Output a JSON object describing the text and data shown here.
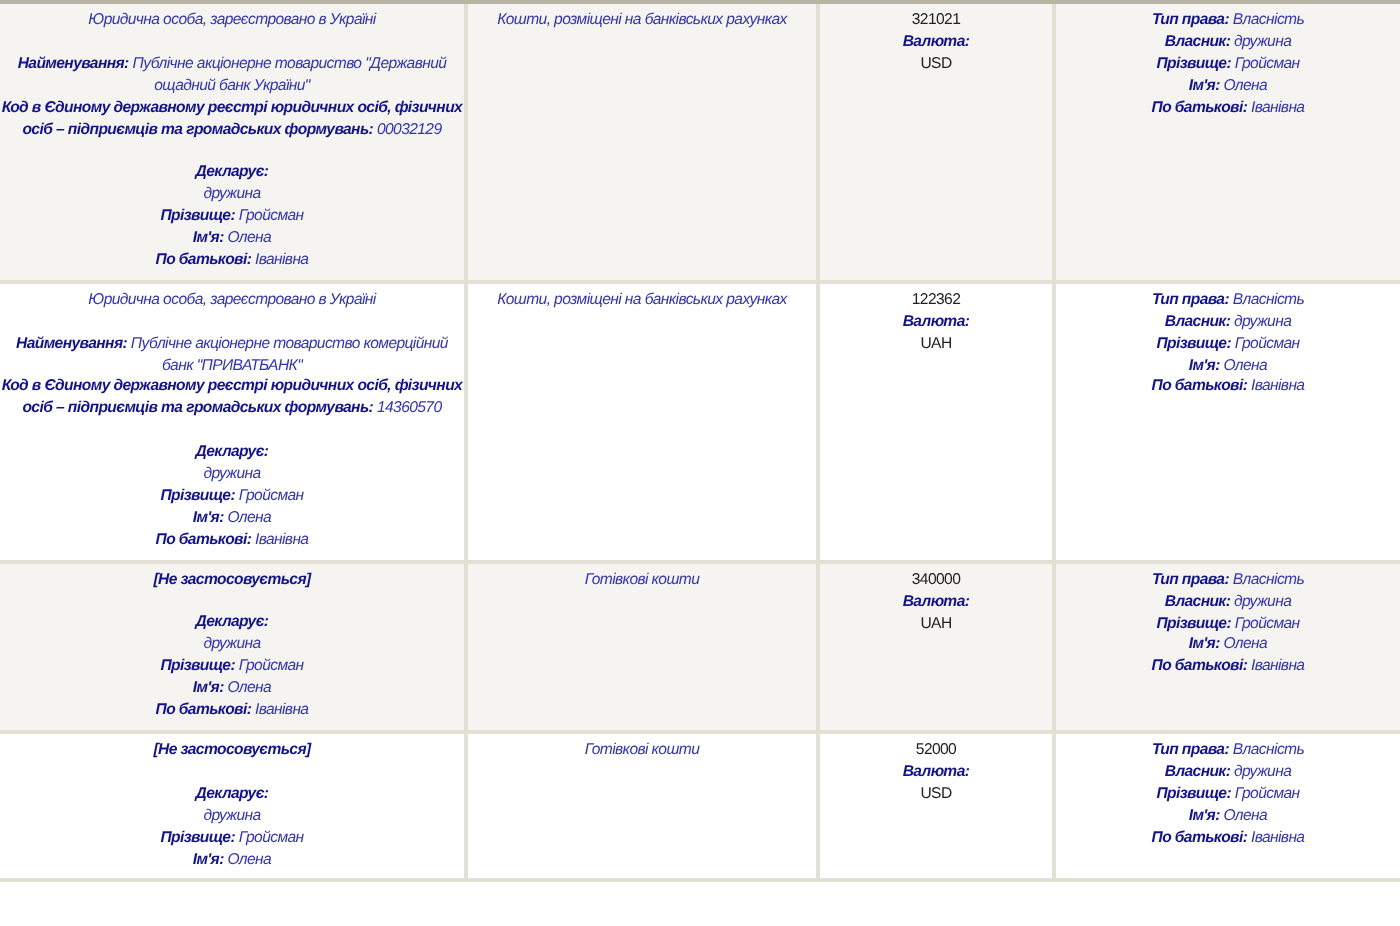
{
  "rows": [
    {
      "entity": {
        "kind": "plain",
        "text": "Юридична особа, зареєстровано в Україні"
      },
      "details": [
        {
          "label": "Найменування:",
          "value": "Публічне акціонерне товариство \"Державний ощадний банк України\""
        },
        {
          "label": "Код в Єдиному державному реєстрі юридичних осіб, фізичних осіб – підприємців та громадських формувань:",
          "value": "00032129"
        }
      ],
      "declarant": {
        "label": "Декларує:",
        "value": "дружина"
      },
      "persons": [
        {
          "label": "Прізвище:",
          "value": "Гройсман"
        },
        {
          "label": "Ім'я:",
          "value": "Олена"
        },
        {
          "label": "По батькові:",
          "value": "Іванівна"
        }
      ],
      "asset_type": "Кошти, розміщені на банківських рахунках",
      "amount": "321021",
      "currency_label": "Валюта:",
      "currency": "USD",
      "rights": [
        {
          "label": "Тип права:",
          "value": "Власність"
        },
        {
          "label": "Власник:",
          "value": "дружина"
        },
        {
          "label": "Прізвище:",
          "value": "Гройсман"
        },
        {
          "label": "Ім'я:",
          "value": "Олена"
        },
        {
          "label": "По батькові:",
          "value": "Іванівна"
        }
      ]
    },
    {
      "entity": {
        "kind": "plain",
        "text": "Юридична особа, зареєстровано в Україні"
      },
      "details": [
        {
          "label": "Найменування:",
          "value": "Публічне акціонерне товариство комерційний банк \"ПРИВАТБАНК\""
        },
        {
          "label": "Код в Єдиному державному реєстрі юридичних осіб, фізичних осіб – підприємців та громадських формувань:",
          "value": "14360570"
        }
      ],
      "declarant": {
        "label": "Декларує:",
        "value": "дружина"
      },
      "persons": [
        {
          "label": "Прізвище:",
          "value": "Гройсман"
        },
        {
          "label": "Ім'я:",
          "value": "Олена"
        },
        {
          "label": "По батькові:",
          "value": "Іванівна"
        }
      ],
      "asset_type": "Кошти, розміщені на банківських рахунках",
      "amount": "122362",
      "currency_label": "Валюта:",
      "currency": "UAH",
      "rights": [
        {
          "label": "Тип права:",
          "value": "Власність"
        },
        {
          "label": "Власник:",
          "value": "дружина"
        },
        {
          "label": "Прізвище:",
          "value": "Гройсман"
        },
        {
          "label": "Ім'я:",
          "value": "Олена"
        },
        {
          "label": "По батькові:",
          "value": "Іванівна"
        }
      ]
    },
    {
      "entity": {
        "kind": "bold",
        "text": "[Не застосовується]"
      },
      "declarant": {
        "label": "Декларує:",
        "value": "дружина"
      },
      "persons": [
        {
          "label": "Прізвище:",
          "value": "Гройсман"
        },
        {
          "label": "Ім'я:",
          "value": "Олена"
        },
        {
          "label": "По батькові:",
          "value": "Іванівна"
        }
      ],
      "asset_type": "Готівкові кошти",
      "amount": "340000",
      "currency_label": "Валюта:",
      "currency": "UAH",
      "rights": [
        {
          "label": "Тип права:",
          "value": "Власність"
        },
        {
          "label": "Власник:",
          "value": "дружина"
        },
        {
          "label": "Прізвище:",
          "value": "Гройсман"
        },
        {
          "label": "Ім'я:",
          "value": "Олена"
        },
        {
          "label": "По батькові:",
          "value": "Іванівна"
        }
      ]
    },
    {
      "entity": {
        "kind": "bold",
        "text": "[Не застосовується]"
      },
      "declarant": {
        "label": "Декларує:",
        "value": "дружина"
      },
      "persons": [
        {
          "label": "Прізвище:",
          "value": "Гройсман"
        },
        {
          "label": "Ім'я:",
          "value": "Олена"
        }
      ],
      "asset_type": "Готівкові кошти",
      "amount": "52000",
      "currency_label": "Валюта:",
      "currency": "USD",
      "rights": [
        {
          "label": "Тип права:",
          "value": "Власність"
        },
        {
          "label": "Власник:",
          "value": "дружина"
        },
        {
          "label": "Прізвище:",
          "value": "Гройсман"
        },
        {
          "label": "Ім'я:",
          "value": "Олена"
        },
        {
          "label": "По батькові:",
          "value": "Іванівна"
        }
      ]
    }
  ]
}
